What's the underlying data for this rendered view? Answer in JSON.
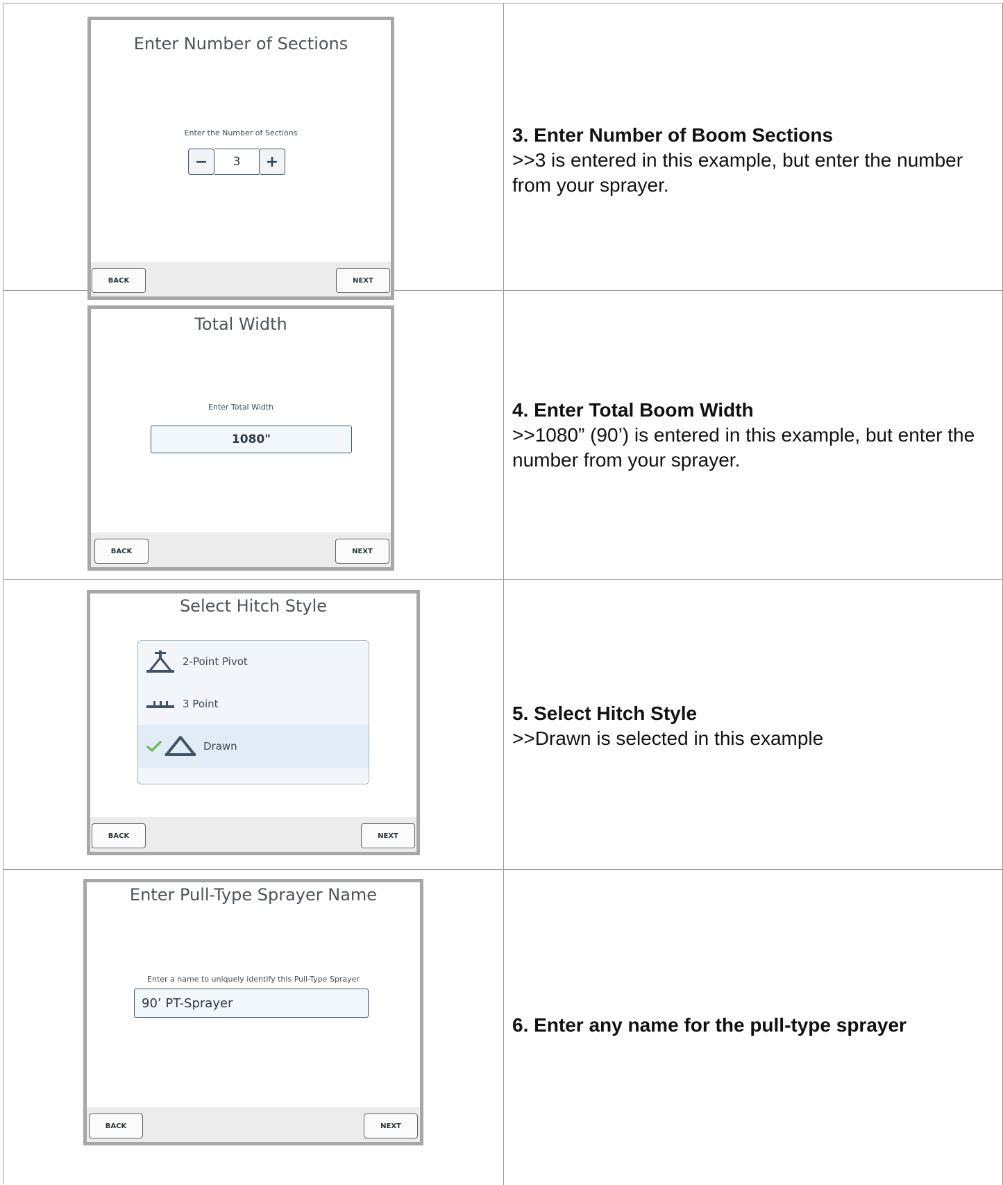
{
  "steps": [
    {
      "screen": {
        "title": "Enter Number of Sections",
        "prompt": "Enter the Number of Sections",
        "stepper": {
          "minus": "−",
          "value": "3",
          "plus": "+"
        },
        "back": "BACK",
        "next": "NEXT"
      },
      "heading": "3. Enter Number of Boom Sections",
      "note": ">>3 is entered in this example, but enter the number from your sprayer."
    },
    {
      "screen": {
        "title": "Total Width",
        "prompt": "Enter Total Width",
        "value": "1080\"",
        "back": "BACK",
        "next": "NEXT"
      },
      "heading": "4. Enter Total Boom Width",
      "note": ">>1080” (90’) is entered in this example, but enter the number from your sprayer."
    },
    {
      "screen": {
        "title": "Select Hitch Style",
        "options": [
          {
            "label": "2-Point Pivot",
            "icon": "two-point-pivot-icon"
          },
          {
            "label": "3 Point",
            "icon": "three-point-icon"
          },
          {
            "label": "Drawn",
            "icon": "drawn-hitch-icon",
            "selected": true
          }
        ],
        "back": "BACK",
        "next": "NEXT"
      },
      "heading": "5. Select Hitch Style",
      "note": ">>Drawn is selected in this example"
    },
    {
      "screen": {
        "title": "Enter Pull-Type Sprayer Name",
        "prompt": "Enter a name to uniquely identify this Pull-Type Sprayer",
        "value": "90’ PT-Sprayer",
        "back": "BACK",
        "next": "NEXT"
      },
      "heading": "6. Enter any name for the pull-type sprayer"
    }
  ],
  "colors": {
    "frame": "#a7a7a7",
    "accent": "#3e5466",
    "check": "#6cbf5a",
    "selected_row": "#e2ecf6"
  }
}
